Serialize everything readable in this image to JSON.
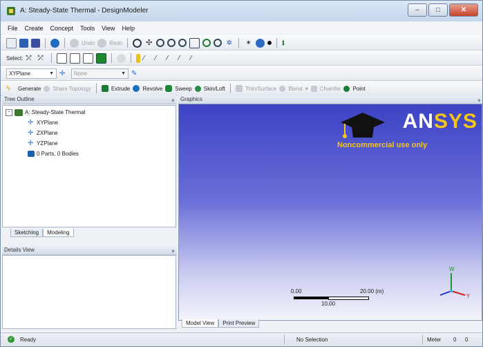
{
  "window": {
    "title": "A: Steady-State Thermal - DesignModeler"
  },
  "window_buttons": {
    "minimize": "–",
    "maximize": "□",
    "close": "✕"
  },
  "menu": [
    "File",
    "Create",
    "Concept",
    "Tools",
    "View",
    "Help"
  ],
  "toolbar1": {
    "undo": "Undo",
    "redo": "Redo"
  },
  "toolbar2": {
    "select": "Select:"
  },
  "toolbar3": {
    "plane": "XYPlane",
    "sketch": "None"
  },
  "toolbar4": {
    "generate": "Generate",
    "share_topology": "Share Topology",
    "extrude": "Extrude",
    "revolve": "Revolve",
    "sweep": "Sweep",
    "skin_loft": "Skin/Loft",
    "thin_surface": "Thin/Surface",
    "blend": "Blend",
    "chamfer": "Chamfer",
    "point": "Point"
  },
  "tree_outline": {
    "header": "Tree Outline",
    "pin": "ᵩ",
    "root": "A: Steady-State Thermal",
    "children": [
      "XYPlane",
      "ZXPlane",
      "YZPlane",
      "0 Parts, 0 Bodies"
    ]
  },
  "left_tabs": [
    "Sketching",
    "Modeling"
  ],
  "details": {
    "header": "Details View",
    "pin": "ᵩ"
  },
  "graphics": {
    "header": "Graphics",
    "pin": "ᵩ",
    "logo_an": "AN",
    "logo_sys": "SYS",
    "noncommercial": "Noncommercial use only",
    "scale_left": "0.00",
    "scale_right": "20.00 (m)",
    "scale_mid": "10.00",
    "axis_x": "Y",
    "axis_y": "W",
    "tabs": [
      "Model View",
      "Print Preview"
    ]
  },
  "status": {
    "ready": "Ready",
    "selection": "No Selection",
    "unit": "Meter",
    "v1": "0",
    "v2": "0"
  },
  "colors": {
    "graphics_top": "#3c43c4",
    "logo_yellow": "#f5c518",
    "ready_green": "#2f9a3a"
  }
}
